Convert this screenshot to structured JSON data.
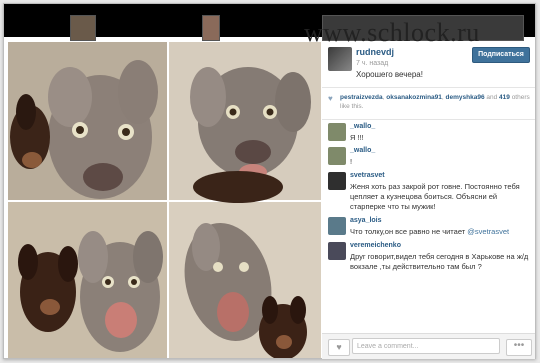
{
  "watermark": "www.schlock.ru",
  "post": {
    "username": "rudnevdj",
    "time": "7 ч. назад",
    "caption": "Хорошего вечера!",
    "subscribe_label": "Подписаться",
    "likes": {
      "users": [
        "pestraizvezda",
        "oksanakozmina91",
        "demyshka96"
      ],
      "separator": ", ",
      "tail_prefix": " and ",
      "others_count": "419",
      "tail_suffix": " others like this."
    }
  },
  "comments": [
    {
      "user": "_wallo_",
      "text": "Я !!!"
    },
    {
      "user": "_wallo_",
      "text": "!"
    },
    {
      "user": "svetrasvet",
      "text": "Женя хоть раз закрой рот говне. Постоянно тебя цепляет а кузнецова боиться. Объясни ей старперке что ты мужик!"
    },
    {
      "user": "asya_lois",
      "text_before": "Что толку,он все равно не читает ",
      "mention": "@svetrasvet"
    },
    {
      "user": "veremeichenko",
      "text": "Друг говорит,видел тебя сегодня в Харькове на ж/д вокзале ,ты действительно там был ?"
    }
  ],
  "footer": {
    "comment_placeholder": "Leave a comment...",
    "more_label": "•••",
    "like_icon": "heart-icon"
  },
  "colors": {
    "accent": "#3f729b",
    "username": "#2a5b84"
  }
}
